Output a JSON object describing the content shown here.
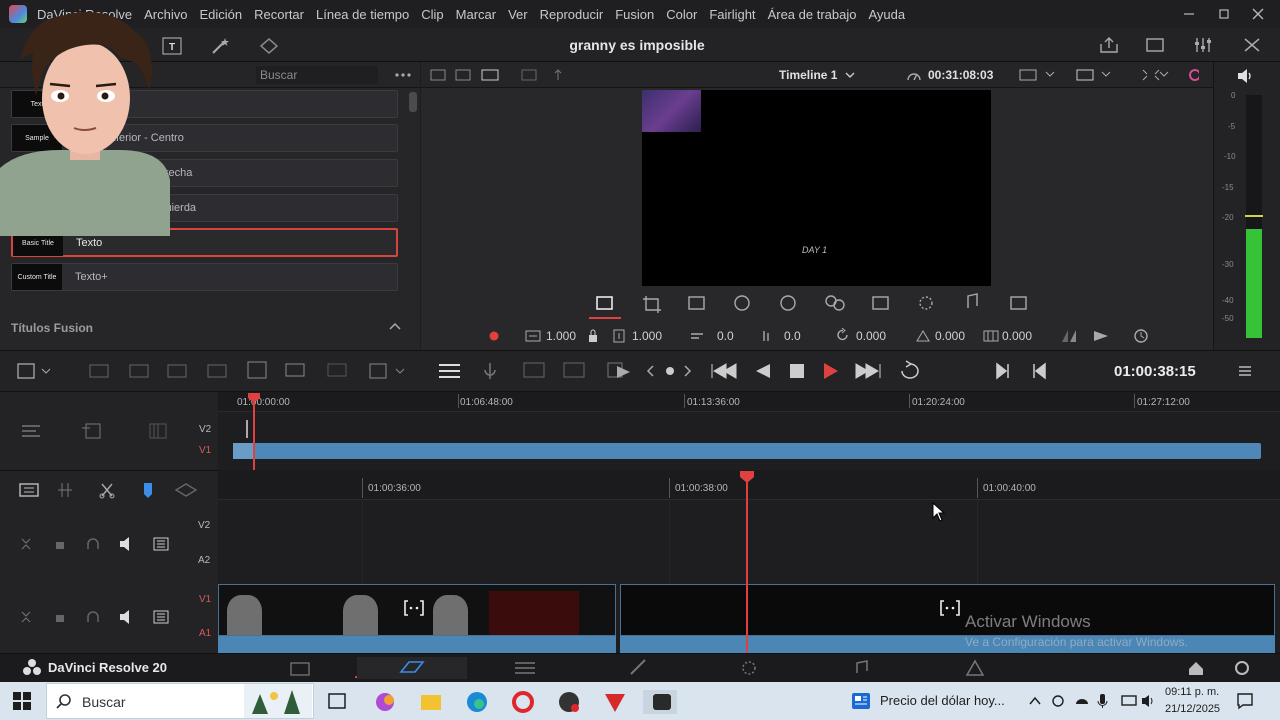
{
  "menu": {
    "items": [
      "DaVinci Resolve",
      "Archivo",
      "Edición",
      "Recortar",
      "Línea de tiempo",
      "Clip",
      "Marcar",
      "Ver",
      "Reproducir",
      "Fusion",
      "Color",
      "Fairlight",
      "Área de trabajo",
      "Ayuda"
    ]
  },
  "project": {
    "title": "granny es imposible"
  },
  "left_panel": {
    "search_placeholder": "Buscar",
    "titles": [
      {
        "thumb": "Text",
        "label": ""
      },
      {
        "thumb": "Sample",
        "label": "Tercio inferior - Centro"
      },
      {
        "thumb": "",
        "label": "Tercio inferior - Derecha"
      },
      {
        "thumb": "",
        "label": "Tercio inferior - Izquierda"
      },
      {
        "thumb": "Basic Title",
        "label": "Texto"
      },
      {
        "thumb": "Custom Title",
        "label": "Texto+"
      }
    ],
    "section_label": "Títulos Fusion"
  },
  "viewer": {
    "timeline_name": "Timeline 1",
    "timecode": "00:31:08:03",
    "overlay_text": "DAY 1",
    "params": {
      "zoom_x": "1.000",
      "zoom_y": "1.000",
      "pos_x": "0.0",
      "pos_y": "0.0",
      "rotation": "0.000",
      "anchor_x": "0.000",
      "anchor_y": "0.000"
    }
  },
  "audio_meter": {
    "ticks": [
      "0",
      "-5",
      "-10",
      "-15",
      "-20",
      "-30",
      "-40",
      "-50"
    ],
    "level_fraction": 0.45,
    "color": "#37c337"
  },
  "transport": {
    "timecode": "01:00:38:15"
  },
  "upper_timeline": {
    "ruler": [
      "01:00:00:00",
      "01:06:48:00",
      "01:13:36:00",
      "01:20:24:00",
      "01:27:12:00"
    ],
    "tracks": [
      "V2",
      "V1"
    ]
  },
  "lower_timeline": {
    "ruler": [
      "01:00:36:00",
      "01:00:38:00",
      "01:00:40:00"
    ],
    "tracks": [
      "V2",
      "A2",
      "V1",
      "A1"
    ]
  },
  "watermark": {
    "title": "Activar Windows",
    "subtitle": "Ve a Configuración para activar Windows."
  },
  "page_nav": {
    "brand": "DaVinci Resolve 20"
  },
  "taskbar": {
    "search": "Buscar",
    "news": "Precio del dólar hoy...",
    "time": "09:11 p. m.",
    "date": "21/12/2025"
  },
  "colors": {
    "accent_red": "#e04040",
    "clip_blue": "#4f88b8",
    "meter_green": "#37c337"
  }
}
